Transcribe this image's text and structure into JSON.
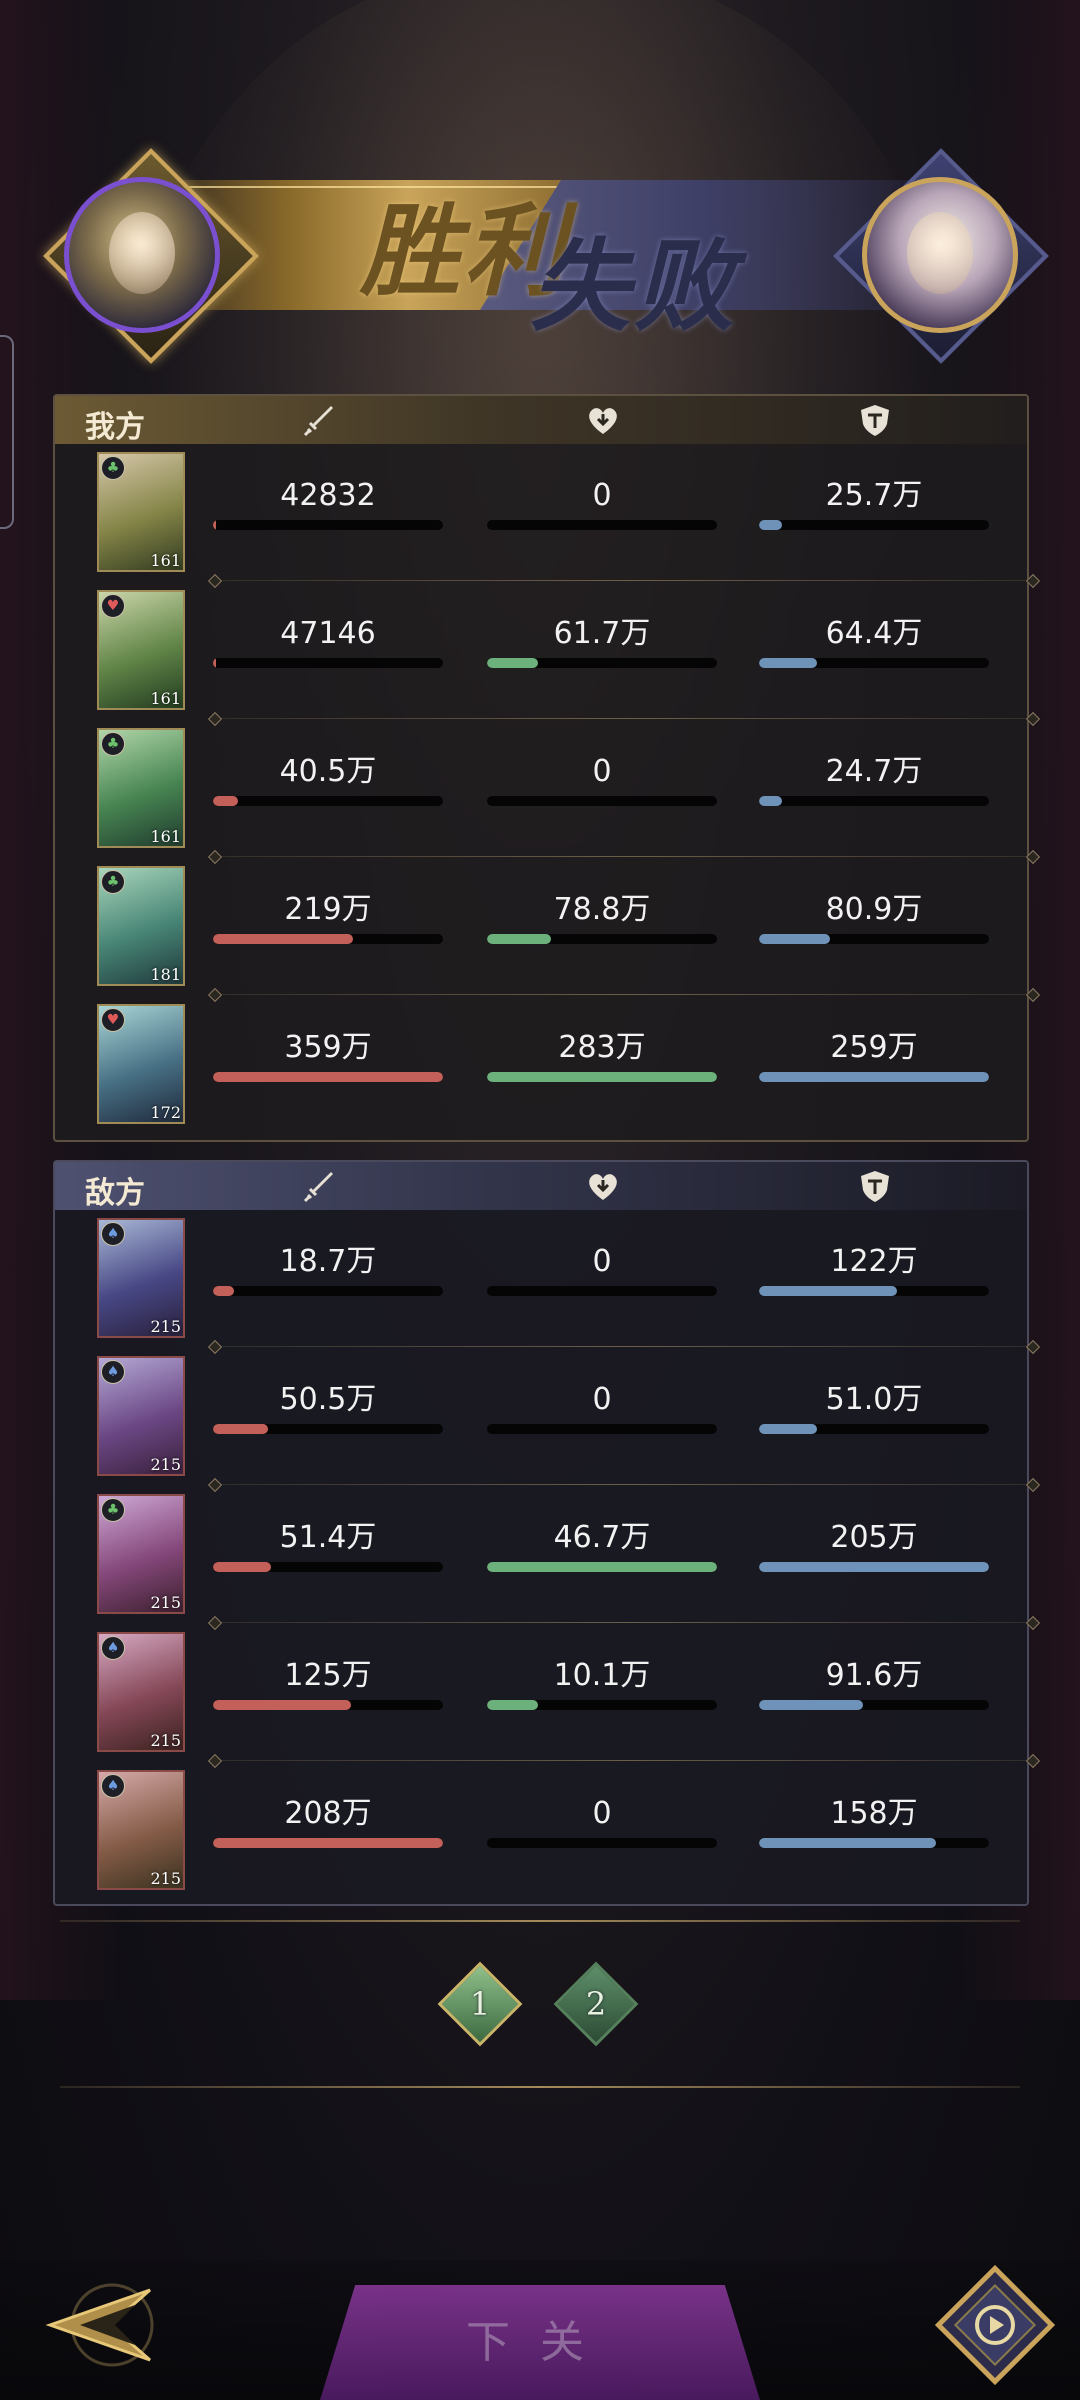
{
  "banner": {
    "left_result": "胜利",
    "right_result": "失败",
    "left_avatar": "player-hero-portrait",
    "right_avatar": "enemy-hero-portrait"
  },
  "columns": {
    "attack_icon": "sword-icon",
    "heal_icon": "heart-icon",
    "defense_icon": "shield-icon"
  },
  "colors": {
    "attack": "#c4605a",
    "heal": "#6cb07c",
    "defense": "#6f93b8"
  },
  "ally": {
    "label": "我方",
    "rows": [
      {
        "level": "161",
        "faction": "green",
        "atk": "42832",
        "heal": "0",
        "def": "25.7万",
        "atk_pct": 0.01,
        "heal_pct": 0,
        "def_pct": 0.1
      },
      {
        "level": "161",
        "faction": "red",
        "atk": "47146",
        "heal": "61.7万",
        "def": "64.4万",
        "atk_pct": 0.01,
        "heal_pct": 0.22,
        "def_pct": 0.25
      },
      {
        "level": "161",
        "faction": "green",
        "atk": "40.5万",
        "heal": "0",
        "def": "24.7万",
        "atk_pct": 0.11,
        "heal_pct": 0,
        "def_pct": 0.1
      },
      {
        "level": "181",
        "faction": "green",
        "atk": "219万",
        "heal": "78.8万",
        "def": "80.9万",
        "atk_pct": 0.61,
        "heal_pct": 0.28,
        "def_pct": 0.31
      },
      {
        "level": "172",
        "faction": "red",
        "atk": "359万",
        "heal": "283万",
        "def": "259万",
        "atk_pct": 1.0,
        "heal_pct": 1.0,
        "def_pct": 1.0
      }
    ]
  },
  "enemy": {
    "label": "敌方",
    "rows": [
      {
        "level": "215",
        "faction": "blue",
        "atk": "18.7万",
        "heal": "0",
        "def": "122万",
        "atk_pct": 0.09,
        "heal_pct": 0,
        "def_pct": 0.6
      },
      {
        "level": "215",
        "faction": "blue",
        "atk": "50.5万",
        "heal": "0",
        "def": "51.0万",
        "atk_pct": 0.24,
        "heal_pct": 0,
        "def_pct": 0.25
      },
      {
        "level": "215",
        "faction": "green",
        "atk": "51.4万",
        "heal": "46.7万",
        "def": "205万",
        "atk_pct": 0.25,
        "heal_pct": 1.0,
        "def_pct": 1.0
      },
      {
        "level": "215",
        "faction": "blue",
        "atk": "125万",
        "heal": "10.1万",
        "def": "91.6万",
        "atk_pct": 0.6,
        "heal_pct": 0.22,
        "def_pct": 0.45
      },
      {
        "level": "215",
        "faction": "blue",
        "atk": "208万",
        "heal": "0",
        "def": "158万",
        "atk_pct": 1.0,
        "heal_pct": 0,
        "def_pct": 0.77
      }
    ]
  },
  "pager": {
    "pages": [
      "1",
      "2"
    ],
    "active": "1"
  },
  "footer": {
    "next_label": "下关",
    "back_icon": "back-arrow-icon",
    "replay_icon": "replay-icon"
  }
}
